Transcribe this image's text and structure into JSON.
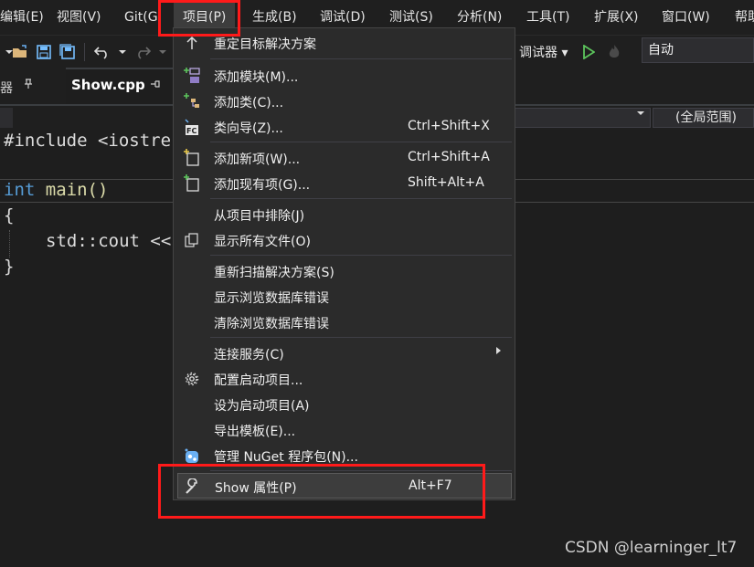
{
  "menubar": {
    "items": [
      "编辑(E)",
      "视图(V)",
      "Git(G",
      "项目(P)",
      "生成(B)",
      "调试(D)",
      "测试(S)",
      "分析(N)",
      "工具(T)",
      "扩展(X)",
      "窗口(W)",
      "帮助"
    ]
  },
  "toolbar": {
    "debugger_label": "调试器 ▾",
    "config_value": "自动",
    "icons": [
      "dropdown-icon",
      "open-folder-icon",
      "save-icon",
      "save-all-icon",
      "undo-icon",
      "redo-icon",
      "play-icon",
      "hot-reload-icon"
    ]
  },
  "tabs": {
    "left_panel_label": "器",
    "file_tab_label": "Show.cpp"
  },
  "navbar": {
    "scope": "(全局范围)"
  },
  "code": {
    "line1": "#include <iostre",
    "line2_kw": "int",
    "line2_fn": " main()",
    "line3": "{",
    "line4": "std::cout <<",
    "line5": "}"
  },
  "project_menu": {
    "items": [
      {
        "label": "重定目标解决方案",
        "shortcut": "",
        "icon": "retarget-icon"
      },
      {
        "label": "添加模块(M)...",
        "shortcut": "",
        "icon": "add-module-icon"
      },
      {
        "label": "添加类(C)...",
        "shortcut": "",
        "icon": "add-class-icon"
      },
      {
        "label": "类向导(Z)...",
        "shortcut": "Ctrl+Shift+X",
        "icon": "class-wizard-icon"
      },
      {
        "label": "添加新项(W)...",
        "shortcut": "Ctrl+Shift+A",
        "icon": "add-new-item-icon"
      },
      {
        "label": "添加现有项(G)...",
        "shortcut": "Shift+Alt+A",
        "icon": "add-existing-item-icon"
      },
      {
        "label": "从项目中排除(J)",
        "shortcut": "",
        "icon": ""
      },
      {
        "label": "显示所有文件(O)",
        "shortcut": "",
        "icon": "show-all-files-icon"
      },
      {
        "label": "重新扫描解决方案(S)",
        "shortcut": "",
        "icon": ""
      },
      {
        "label": "显示浏览数据库错误",
        "shortcut": "",
        "icon": ""
      },
      {
        "label": "清除浏览数据库错误",
        "shortcut": "",
        "icon": ""
      },
      {
        "label": "连接服务(C)",
        "shortcut": "",
        "icon": ""
      },
      {
        "label": "配置启动项目...",
        "shortcut": "",
        "icon": "gear-icon"
      },
      {
        "label": "设为启动项目(A)",
        "shortcut": "",
        "icon": ""
      },
      {
        "label": "导出模板(E)...",
        "shortcut": "",
        "icon": ""
      },
      {
        "label": "管理 NuGet 程序包(N)...",
        "shortcut": "",
        "icon": "nuget-icon"
      },
      {
        "label": "Show 属性(P)",
        "shortcut": "Alt+F7",
        "icon": "wrench-icon"
      }
    ]
  },
  "watermark": "CSDN @learninger_lt7"
}
